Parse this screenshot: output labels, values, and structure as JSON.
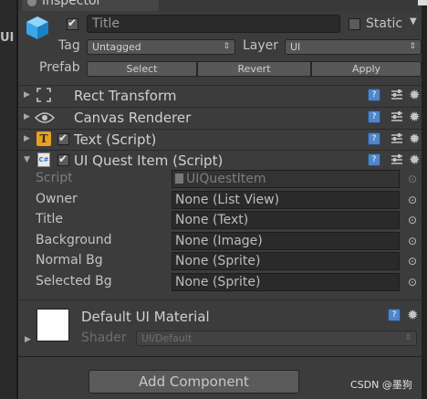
{
  "tab": {
    "title": "Inspector"
  },
  "left_strip": {
    "label": "UI"
  },
  "object": {
    "name": "Title",
    "static_label": "Static",
    "tag_label": "Tag",
    "tag_value": "Untagged",
    "layer_label": "Layer",
    "layer_value": "UI",
    "prefab_label": "Prefab",
    "prefab_buttons": [
      "Select",
      "Revert",
      "Apply"
    ]
  },
  "components": [
    {
      "name": "Rect Transform",
      "icon": "rect-transform-icon",
      "has_checkbox": false
    },
    {
      "name": "Canvas Renderer",
      "icon": "eye-icon",
      "has_checkbox": false
    },
    {
      "name": "Text (Script)",
      "icon": "text-icon",
      "has_checkbox": true
    },
    {
      "name": "UI Quest Item (Script)",
      "icon": "script-icon",
      "has_checkbox": true
    }
  ],
  "script_props": {
    "script_label": "Script",
    "script_value": "UIQuestItem",
    "fields": [
      {
        "label": "Owner",
        "value": "None (List View)"
      },
      {
        "label": "Title",
        "value": "None (Text)"
      },
      {
        "label": "Background",
        "value": "None (Image)"
      },
      {
        "label": "Normal Bg",
        "value": "None (Sprite)"
      },
      {
        "label": "Selected Bg",
        "value": "None (Sprite)"
      }
    ]
  },
  "material": {
    "name": "Default UI Material",
    "shader_label": "Shader",
    "shader_value": "UI/Default"
  },
  "add_component": "Add Component",
  "watermark": "CSDN @墨狗",
  "colors": {
    "background": "#383838",
    "panel": "#3c3c3c",
    "help_icon": "#4f86c6",
    "text": "#c4c4c4"
  }
}
